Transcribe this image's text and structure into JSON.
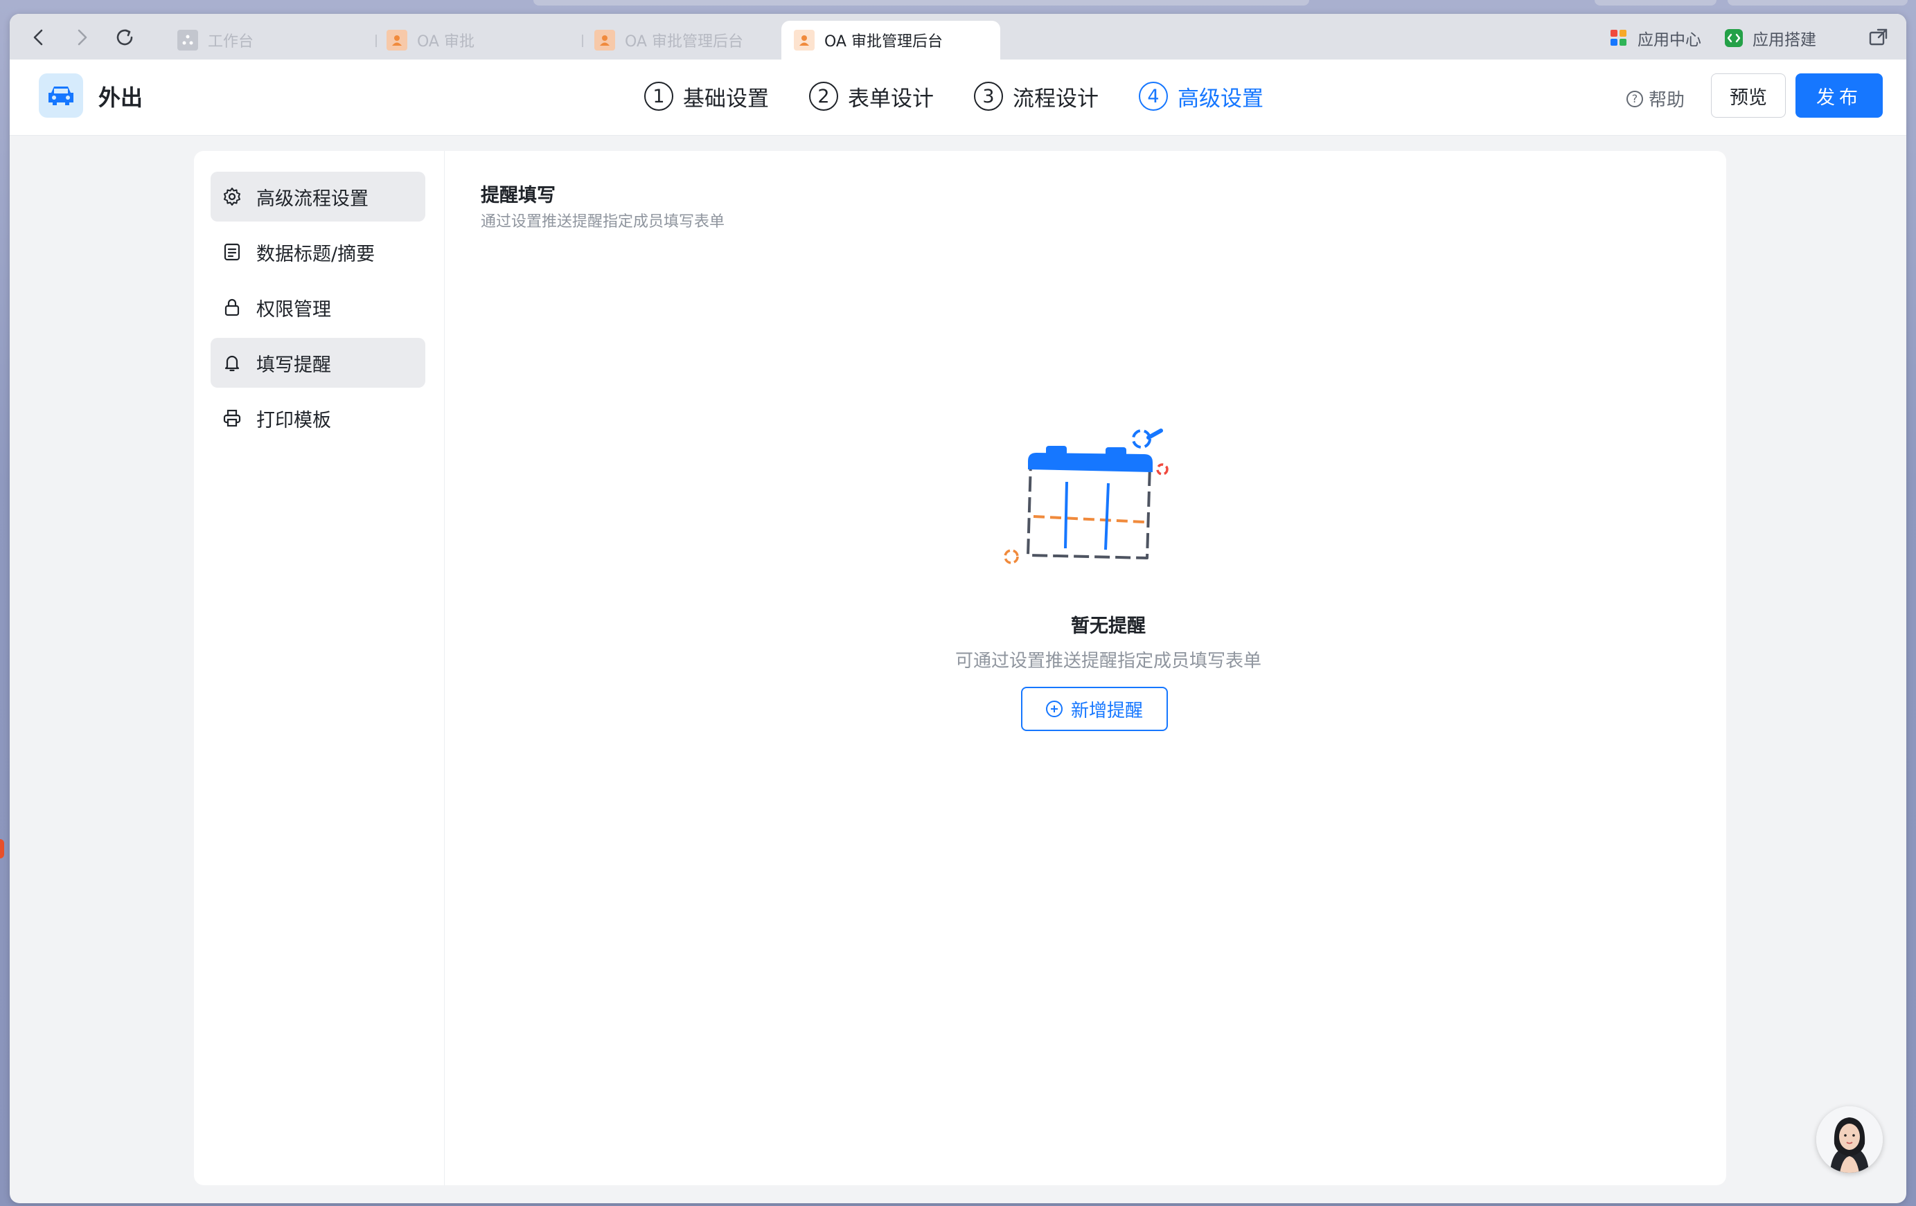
{
  "browser": {
    "tabs": [
      {
        "label": "工作台",
        "active": false
      },
      {
        "label": "OA 审批",
        "active": false
      },
      {
        "label": "OA 审批管理后台",
        "active": false
      },
      {
        "label": "OA 审批管理后台",
        "active": true
      }
    ],
    "app_center_label": "应用中心",
    "app_builder_label": "应用搭建"
  },
  "header": {
    "app_title": "外出",
    "steps": [
      {
        "num": "1",
        "label": "基础设置"
      },
      {
        "num": "2",
        "label": "表单设计"
      },
      {
        "num": "3",
        "label": "流程设计"
      },
      {
        "num": "4",
        "label": "高级设置",
        "active": true
      }
    ],
    "help_label": "帮助",
    "preview_label": "预览",
    "publish_label": "发布"
  },
  "sidebar": {
    "items": [
      {
        "label": "高级流程设置",
        "icon": "gear-icon"
      },
      {
        "label": "数据标题/摘要",
        "icon": "document-icon"
      },
      {
        "label": "权限管理",
        "icon": "lock-icon"
      },
      {
        "label": "填写提醒",
        "icon": "bell-icon",
        "active": true
      },
      {
        "label": "打印模板",
        "icon": "printer-icon"
      }
    ]
  },
  "main": {
    "section_title": "提醒填写",
    "section_desc": "通过设置推送提醒指定成员填写表单",
    "empty_title": "暂无提醒",
    "empty_desc": "可通过设置推送提醒指定成员填写表单",
    "add_button_label": "新增提醒"
  },
  "colors": {
    "accent": "#1677ff",
    "text_primary": "#1f2329",
    "text_secondary": "#8f959e",
    "active_menu_bg": "#eaebee"
  }
}
